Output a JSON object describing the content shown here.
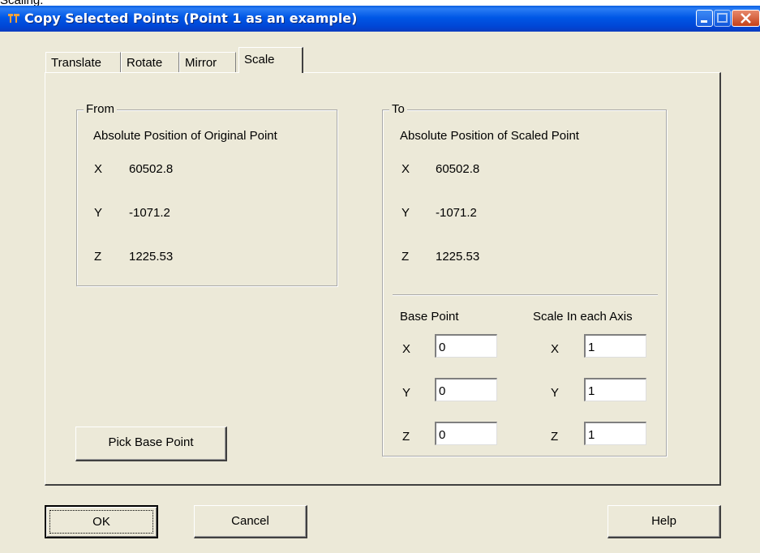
{
  "page_caption": "Scaling.",
  "window": {
    "title": "Copy Selected Points (Point 1 as an example)"
  },
  "tabs": [
    {
      "label": "Translate"
    },
    {
      "label": "Rotate"
    },
    {
      "label": "Mirror"
    },
    {
      "label": "Scale",
      "active": true
    }
  ],
  "from": {
    "legend": "From",
    "heading": "Absolute Position of Original Point",
    "x_label": "X",
    "x_value": "60502.8",
    "y_label": "Y",
    "y_value": "-1071.2",
    "z_label": "Z",
    "z_value": "1225.53"
  },
  "to": {
    "legend": "To",
    "heading": "Absolute Position of Scaled Point",
    "x_label": "X",
    "x_value": "60502.8",
    "y_label": "Y",
    "y_value": "-1071.2",
    "z_label": "Z",
    "z_value": "1225.53",
    "base_point": {
      "heading": "Base Point",
      "x_label": "X",
      "x_value": "0",
      "y_label": "Y",
      "y_value": "0",
      "z_label": "Z",
      "z_value": "0"
    },
    "scale": {
      "heading": "Scale In each Axis",
      "x_label": "X",
      "x_value": "1",
      "y_label": "Y",
      "y_value": "1",
      "z_label": "Z",
      "z_value": "1"
    }
  },
  "buttons": {
    "pick_base_point": "Pick Base Point",
    "ok": "OK",
    "cancel": "Cancel",
    "help": "Help"
  }
}
